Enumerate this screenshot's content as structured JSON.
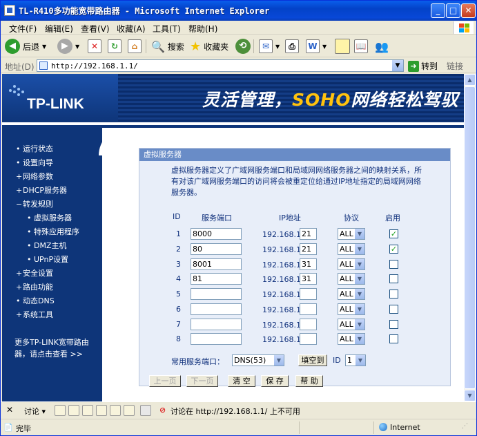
{
  "window": {
    "title": "TL-R410多功能宽带路由器 - Microsoft Internet Explorer"
  },
  "menu": [
    "文件(F)",
    "编辑(E)",
    "查看(V)",
    "收藏(A)",
    "工具(T)",
    "帮助(H)"
  ],
  "toolbar": {
    "back": "后退",
    "search": "搜索",
    "favorites": "收藏夹"
  },
  "address": {
    "label": "地址(D)",
    "url": "http://192.168.1.1/",
    "go": "转到",
    "links": "链接"
  },
  "banner": {
    "logo": "TP-LINK",
    "slogan_a": "灵活管理，",
    "slogan_b": "SOHO",
    "slogan_c": "网络轻松驾驭"
  },
  "sidebar": {
    "items": [
      {
        "label": "运行状态",
        "marker": "•"
      },
      {
        "label": "设置向导",
        "marker": "•"
      },
      {
        "label": "网络参数",
        "marker": "+"
      },
      {
        "label": "DHCP服务器",
        "marker": "+"
      },
      {
        "label": "转发规则",
        "marker": "−"
      },
      {
        "label": "虚拟服务器",
        "marker": "•"
      },
      {
        "label": "特殊应用程序",
        "marker": "•"
      },
      {
        "label": "DMZ主机",
        "marker": "•"
      },
      {
        "label": "UPnP设置",
        "marker": "•"
      },
      {
        "label": "安全设置",
        "marker": "+"
      },
      {
        "label": "路由功能",
        "marker": "+"
      },
      {
        "label": "动态DNS",
        "marker": "•"
      },
      {
        "label": "系统工具",
        "marker": "+"
      }
    ],
    "footer": "更多TP-LINK宽带路由器，请点击查看 >>"
  },
  "panel": {
    "title": "虚拟服务器",
    "description": "虚拟服务器定义了广域网服务端口和局域网网络服务器之间的映射关系，所有对该广域网服务端口的访问将会被重定位给通过IP地址指定的局域网网络服务器。",
    "headers": {
      "id": "ID",
      "port": "服务端口",
      "ip": "IP地址",
      "protocol": "协议",
      "enable": "启用"
    },
    "ip_prefix": "192.168.1.",
    "rows": [
      {
        "id": "1",
        "port": "8000",
        "ip": "21",
        "protocol": "ALL",
        "enabled": "✓"
      },
      {
        "id": "2",
        "port": "80",
        "ip": "21",
        "protocol": "ALL",
        "enabled": "✓"
      },
      {
        "id": "3",
        "port": "8001",
        "ip": "31",
        "protocol": "ALL",
        "enabled": ""
      },
      {
        "id": "4",
        "port": "81",
        "ip": "31",
        "protocol": "ALL",
        "enabled": ""
      },
      {
        "id": "5",
        "port": "",
        "ip": "",
        "protocol": "ALL",
        "enabled": ""
      },
      {
        "id": "6",
        "port": "",
        "ip": "",
        "protocol": "ALL",
        "enabled": ""
      },
      {
        "id": "7",
        "port": "",
        "ip": "",
        "protocol": "ALL",
        "enabled": ""
      },
      {
        "id": "8",
        "port": "",
        "ip": "",
        "protocol": "ALL",
        "enabled": ""
      }
    ],
    "common_port_label": "常用服务端口：",
    "common_port_value": "DNS(53)",
    "fill_button": "填空到",
    "id_label": "ID",
    "id_value": "1",
    "buttons": {
      "prev": "上一页",
      "next": "下一页",
      "clear": "清 空",
      "save": "保 存",
      "help": "帮 助"
    }
  },
  "linksbar": {
    "discuss": "讨论 ▾",
    "message": "讨论在 http://192.168.1.1/ 上不可用"
  },
  "status": {
    "text": "完毕",
    "zone": "Internet"
  }
}
